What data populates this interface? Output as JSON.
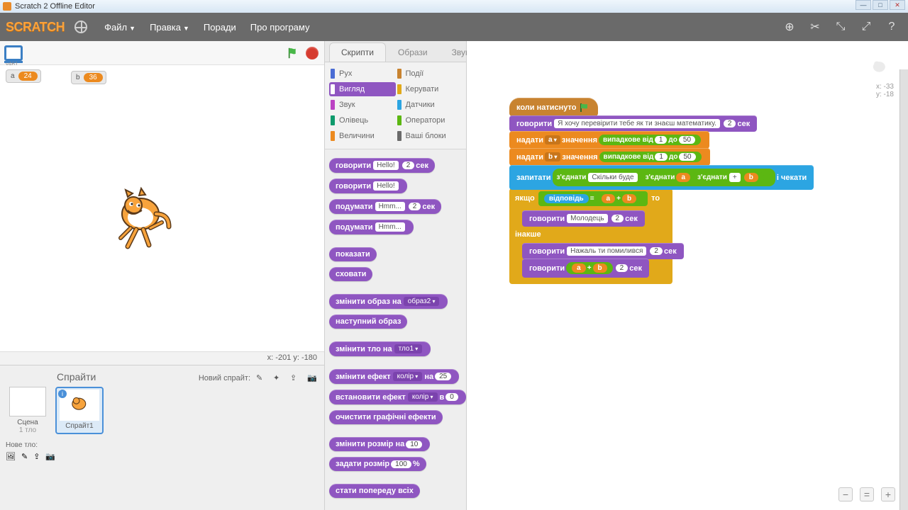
{
  "window": {
    "title": "Scratch 2 Offline Editor"
  },
  "menu": {
    "file": "Файл",
    "edit": "Правка",
    "tips": "Поради",
    "about": "Про програму"
  },
  "stage": {
    "dim": "v461",
    "var_a_name": "a",
    "var_a_val": "24",
    "var_b_name": "b",
    "var_b_val": "36",
    "coords": "x: -201  y: -180"
  },
  "sprite_pane": {
    "title": "Спрайти",
    "new_label": "Новий спрайт:",
    "stage_label": "Сцена",
    "stage_sub": "1 тло",
    "sprite1": "Спрайт1",
    "new_bg": "Нове тло:"
  },
  "tabs": {
    "scripts": "Скрипти",
    "costumes": "Образи",
    "sounds": "Звуки"
  },
  "cats": {
    "motion": "Рух",
    "looks": "Вигляд",
    "sound": "Звук",
    "pen": "Олівець",
    "data": "Величини",
    "events": "Події",
    "control": "Керувати",
    "sensing": "Датчики",
    "operators": "Оператори",
    "more": "Ваші блоки"
  },
  "palette": {
    "say": "говорити",
    "think": "подумати",
    "hello": "Hello!",
    "hmm": "Hmm...",
    "sec": "сек",
    "two": "2",
    "show": "показати",
    "hide": "сховати",
    "switch_cost": "змінити образ на",
    "cost2": "образ2",
    "next_cost": "наступний образ",
    "switch_bg": "змінити тло на",
    "bg1": "тло1",
    "change_eff": "змінити ефект",
    "color": "колір",
    "by": "на",
    "v25": "25",
    "set_eff": "встановити ефект",
    "to": "в",
    "v0": "0",
    "clear_eff": "очистити графічні ефекти",
    "change_size": "змінити розмір на",
    "v10": "10",
    "set_size": "задати розмір",
    "v100": "100",
    "pct": "%",
    "front": "стати попереду всіх"
  },
  "script": {
    "when_flag": "коли натиснуто",
    "say": "говорити",
    "sec": "сек",
    "two": "2",
    "intro": "Я хочу перевірити тебе як ти знаєш математику.",
    "set": "надати",
    "a": "a",
    "b": "b",
    "value": "значення",
    "rand": "випадкове від",
    "to": "до",
    "one": "1",
    "fifty": "50",
    "ask": "запитати",
    "join": "з'єднати",
    "howmuch": "Скільки буде",
    "wait": "і чекати",
    "if": "якщо",
    "answer": "відповідь",
    "then": "то",
    "else": "інакше",
    "good": "Молодець",
    "bad": "Нажаль ти помилився",
    "plus": "+"
  },
  "thumb": {
    "x": "x: -33",
    "y": "y: -18"
  }
}
